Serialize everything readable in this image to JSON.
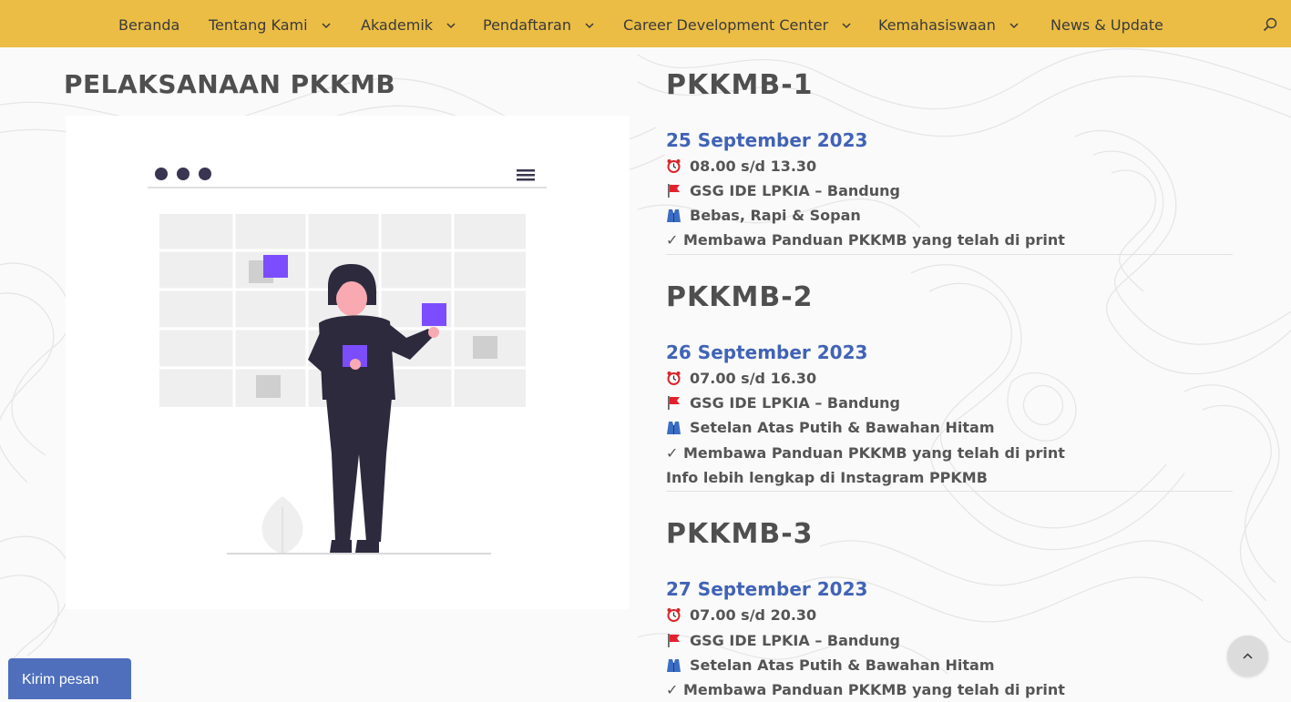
{
  "nav": {
    "items": [
      {
        "label": "Beranda",
        "dropdown": false
      },
      {
        "label": "Tentang Kami",
        "dropdown": true
      },
      {
        "label": "Akademik",
        "dropdown": true
      },
      {
        "label": "Pendaftaran",
        "dropdown": true
      },
      {
        "label": "Career Development Center",
        "dropdown": true
      },
      {
        "label": "Kemahasiswaan",
        "dropdown": true
      },
      {
        "label": "News & Update",
        "dropdown": false
      }
    ],
    "search_icon": "search-icon",
    "background": "#ebbd45"
  },
  "left": {
    "title": "PELAKSANAAN PKKMB"
  },
  "sections": [
    {
      "title": "PKKMB-1",
      "date": "25 September 2023",
      "time": "08.00 s/d 13.30",
      "place": "GSG IDE LPKIA – Bandung",
      "dress": "Bebas, Rapi & Sopan",
      "note": "✓ Membawa Panduan PKKMB yang telah di print"
    },
    {
      "title": "PKKMB-2",
      "date": "26 September 2023",
      "time": "07.00 s/d 16.30",
      "place": "GSG IDE LPKIA – Bandung",
      "dress": "Setelan Atas Putih & Bawahan Hitam",
      "note": "✓ Membawa Panduan PKKMB yang telah di print",
      "extra": "Info lebih lengkap di Instagram PPKMB"
    },
    {
      "title": "PKKMB-3",
      "date": "27 September 2023",
      "time": "07.00 s/d 20.30",
      "place": "GSG IDE LPKIA – Bandung",
      "dress": "Setelan Atas Putih & Bawahan Hitam",
      "note": "✓ Membawa Panduan PKKMB yang telah di print"
    }
  ],
  "colors": {
    "date": "#4163b6",
    "accent_purple": "#7b4dff",
    "chat_button": "#4f6fbd"
  },
  "chat": {
    "label": "Kirim pesan"
  },
  "scroll_top_icon": "chevron-up-icon"
}
